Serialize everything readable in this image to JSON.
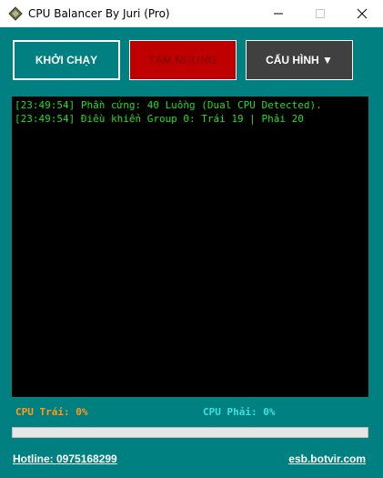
{
  "window": {
    "title": "CPU Balancer By Juri (Pro)",
    "icon": "diamond-app-icon"
  },
  "toolbar": {
    "start_label": "KHỞI CHẠY",
    "pause_label": "TẠM NGƯNG",
    "config_label": "CẤU HÌNH ▼"
  },
  "log": {
    "lines": [
      "[23:49:54] Phần cứng: 40 Luồng (Dual CPU Detected).",
      "[23:49:54] Điều khiển Group 0: Trái 19 | Phải 20"
    ]
  },
  "status": {
    "cpu_left": "CPU Trái: 0%",
    "cpu_right": "CPU Phải: 0%",
    "progress_percent": 0
  },
  "footer": {
    "hotline": "Hotline: 0975168299",
    "website": "esb.botvir.com"
  },
  "colors": {
    "background": "#008080",
    "pause_button": "#c00000",
    "config_button": "#404040",
    "log_text": "#22dd22",
    "cpu_left_text": "#ff9a1f",
    "cpu_right_text": "#3fe0e0"
  }
}
